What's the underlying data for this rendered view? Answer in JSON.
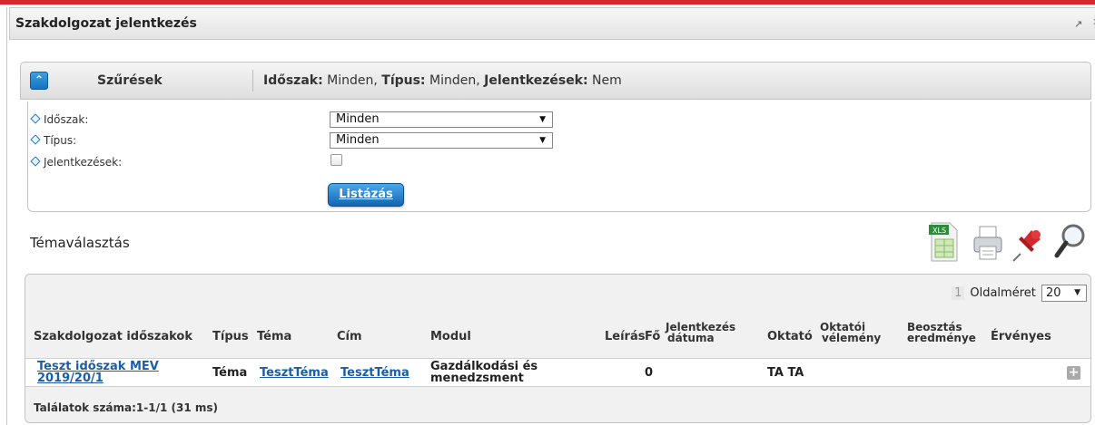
{
  "window": {
    "title": "Szakdolgozat jelentkezés",
    "external_icon": "↗",
    "close_icon": "✕"
  },
  "filter_bar": {
    "toggle_icon": "double-chevron-up-icon",
    "label": "Szűrések",
    "summary": {
      "period_key": "Időszak:",
      "period_val": "Minden,",
      "type_key": "Típus:",
      "type_val": "Minden,",
      "reg_key": "Jelentkezések:",
      "reg_val": "Nem"
    }
  },
  "filters": {
    "period_label": "Időszak:",
    "period_value": "Minden",
    "type_label": "Típus:",
    "type_value": "Minden",
    "registrations_label": "Jelentkezések:",
    "registrations_checked": false,
    "list_button": "Listázás"
  },
  "section": {
    "title": "Témaválasztás",
    "tools": [
      "excel-export-icon",
      "printer-icon",
      "pin-icon",
      "search-icon"
    ]
  },
  "table": {
    "pager": {
      "page": "1",
      "page_size_label": "Oldalméret",
      "page_size": "20"
    },
    "headers": {
      "period": "Szakdolgozat időszakok",
      "type": "Típus",
      "topic": "Téma",
      "title": "Cím",
      "module": "Modul",
      "description": "Leírás",
      "count": "Fő",
      "reg_date_1": "Jelentkezés",
      "reg_date_2": "dátuma",
      "instructor": "Oktató",
      "opinion_1": "Oktatói",
      "opinion_2": "vélemény",
      "assign_1": "Beosztás",
      "assign_2": "eredménye",
      "valid": "Érvényes"
    },
    "rows": [
      {
        "period_1": "Teszt időszak MEV",
        "period_2": "2019/20/1",
        "type": "Téma",
        "topic": "TesztTéma",
        "title": "TesztTéma",
        "module_1": "Gazdálkodási és",
        "module_2": "menedzsment",
        "count": "0",
        "instructor": "TA TA"
      }
    ],
    "footer": "Találatok száma:1-1/1 (31 ms)"
  }
}
